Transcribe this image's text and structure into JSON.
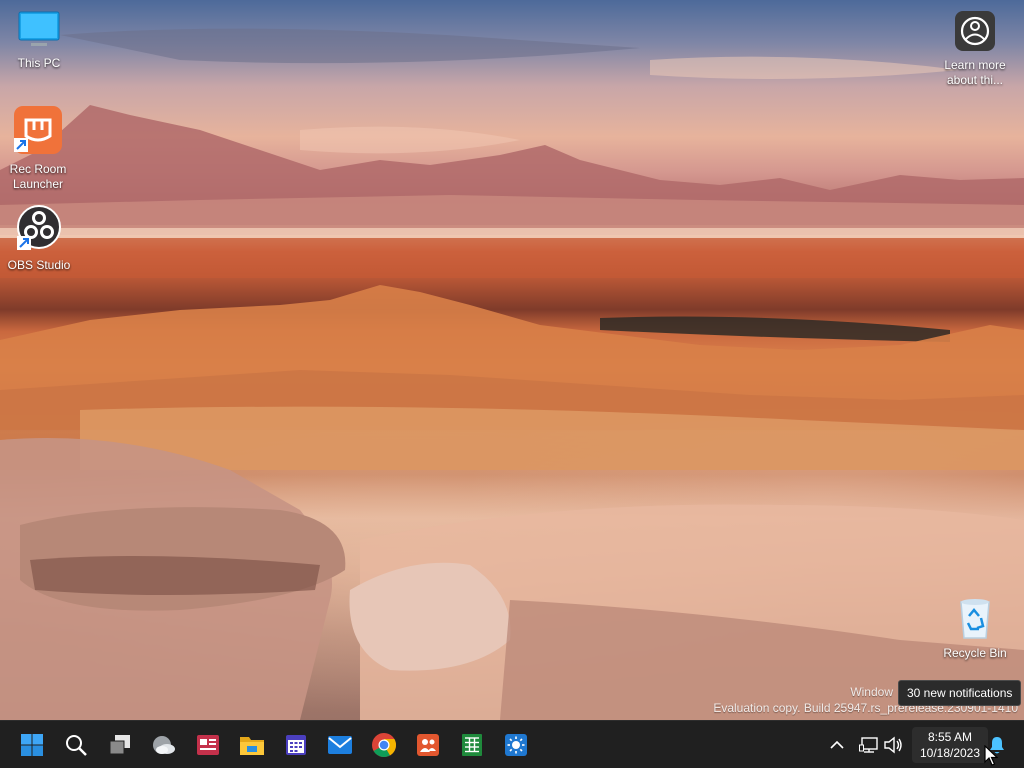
{
  "desktop": {
    "icons": [
      {
        "label": "This PC",
        "icon": "monitor-icon"
      },
      {
        "label": "Rec Room Launcher",
        "icon": "rec-room-icon"
      },
      {
        "label": "OBS Studio",
        "icon": "obs-icon"
      },
      {
        "label": "Learn more about thi...",
        "icon": "learn-more-icon"
      },
      {
        "label": "Recycle Bin",
        "icon": "recycle-bin-icon"
      }
    ],
    "watermark": {
      "line1": "Window",
      "line2": "Evaluation copy. Build 25947.rs_prerelease.230901-1410"
    }
  },
  "tooltip": {
    "text": "30 new notifications"
  },
  "taskbar": {
    "apps": [
      "start-icon",
      "search-icon",
      "task-view-icon",
      "widgets-icon",
      "news-icon",
      "file-explorer-icon",
      "calendar-icon",
      "mail-icon",
      "chrome-icon",
      "teams-icon",
      "spreadsheet-icon",
      "weather-icon"
    ],
    "clock": {
      "time": "8:55 AM",
      "date": "10/18/2023"
    },
    "colors": {
      "background": "#202020",
      "accent": "#4cc2ff"
    }
  }
}
